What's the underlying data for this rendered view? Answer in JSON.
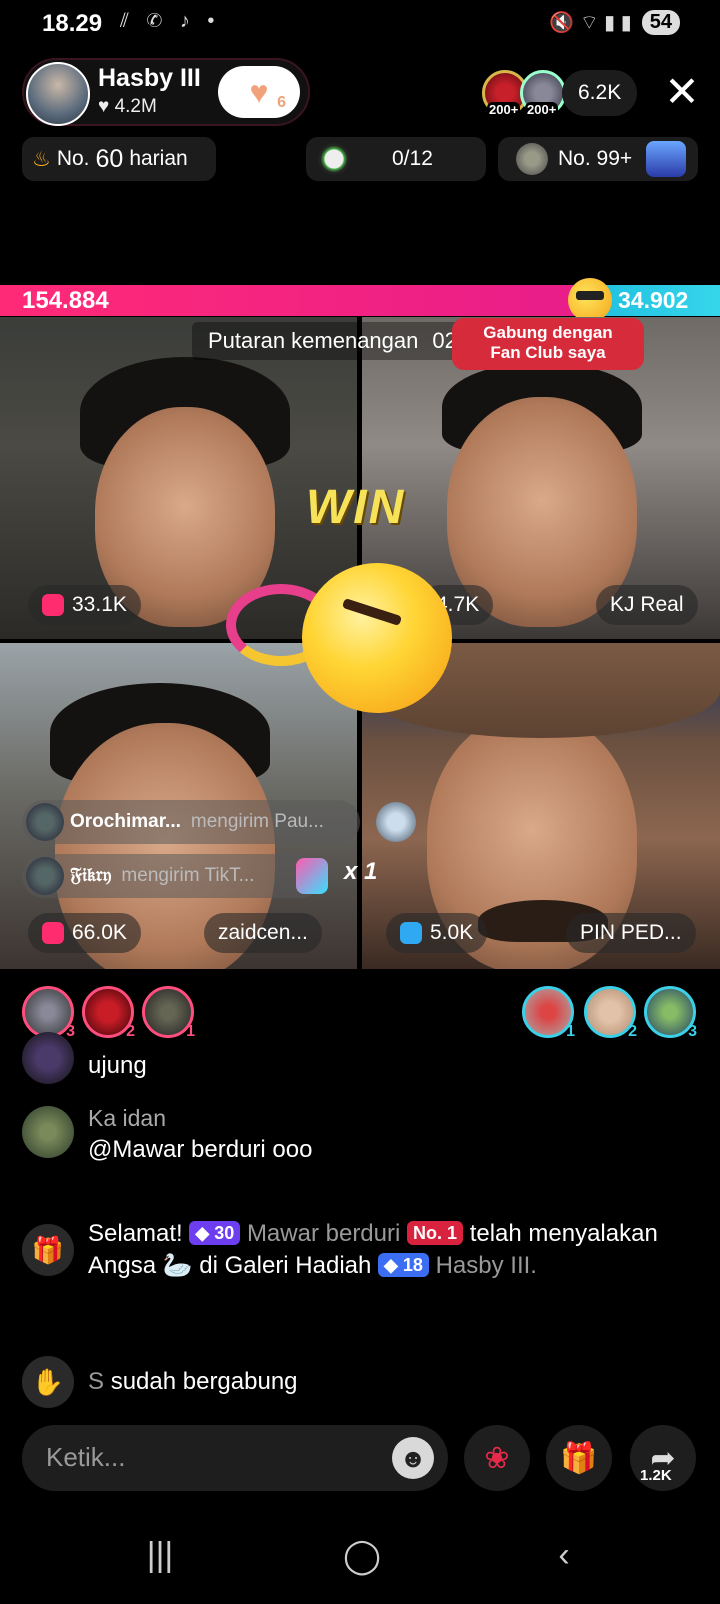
{
  "status": {
    "time": "18.29",
    "left_icons": "⫽ ✆ ♪ •",
    "right_icons": "🔇 ⌔ ▮ ▮",
    "battery": "54"
  },
  "host": {
    "name": "Hasby III",
    "likes": "4.2M",
    "follow_badge": "6"
  },
  "viewers": {
    "badge_1": "200+",
    "badge_2": "200+",
    "count": "6.2K"
  },
  "chips": {
    "daily_rank_prefix": "No.",
    "daily_rank_num": "60",
    "daily_rank_suffix": "harian",
    "goal": "0/12",
    "rank2": "No. 99+"
  },
  "battle": {
    "score_left": "154.884",
    "score_right": "34.902",
    "round_label": "Putaran kemenangan",
    "timer": "02:59",
    "fanclub_line1": "Gabung dengan",
    "fanclub_line2": "Fan Club saya",
    "win": "WIN",
    "win_fraction": 0.82
  },
  "cells": {
    "tl_score": "33.1K",
    "tr_score": "4.7K",
    "tr_name": "KJ Real",
    "bl_score": "66.0K",
    "bl_name": "zaidcen...",
    "br_score": "5.0K",
    "br_name": "PIN PED..."
  },
  "gift_banners": [
    {
      "name": "Orochimar...",
      "text": "mengirim Pau..."
    },
    {
      "name": "𝔉𝔦𝔨𝔯𝔶",
      "text": "mengirim TikT...",
      "multiplier": "x 1"
    }
  ],
  "supporters": {
    "left": [
      "3",
      "2",
      "1"
    ],
    "right": [
      "1",
      "2",
      "3"
    ]
  },
  "chat": [
    {
      "user": "",
      "text": "ujung"
    },
    {
      "user": "Ka idan",
      "text": "@Mawar berduri ooo"
    },
    {
      "prefix": "Selamat!",
      "badge1": "30",
      "user": "Mawar berduri",
      "rank_badge": "No. 1",
      "mid": "telah menyalakan Angsa 🦢 di Galeri Hadiah",
      "badge2": "18",
      "host": "Hasby III."
    },
    {
      "user": "S",
      "text": "sudah bergabung"
    }
  ],
  "bottom": {
    "placeholder": "Ketik...",
    "share_count": "1.2K"
  },
  "icons": {
    "close": "close-icon",
    "gift": "gift-icon",
    "rose": "rose-icon",
    "share": "share-icon",
    "emoji": "emoji-icon",
    "wave": "wave-icon"
  },
  "colors": {
    "pink": "#ff2a77",
    "cyan": "#20bfe0",
    "win_yellow": "#f6e35a"
  }
}
